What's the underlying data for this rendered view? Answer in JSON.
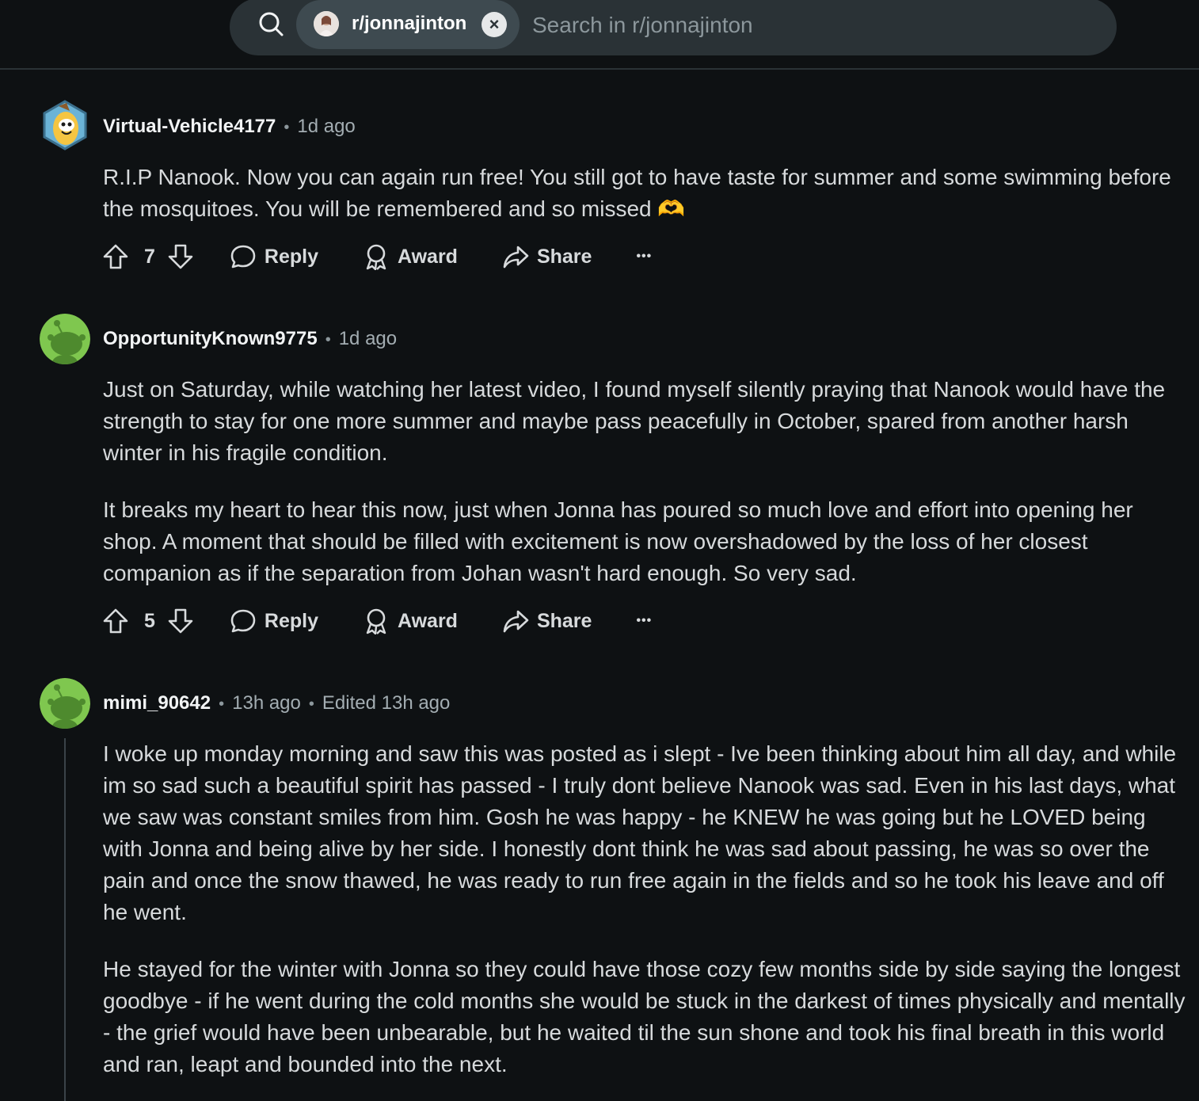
{
  "search": {
    "community_chip": "r/jonnajinton",
    "placeholder": "Search in r/jonnajinton",
    "close_glyph": "×"
  },
  "comments": [
    {
      "author": "Virtual-Vehicle4177",
      "separator": "•",
      "time": "1d ago",
      "paragraphs": [
        "R.I.P Nanook. Now you can again run free! You still got to have taste for summer and some swimming before the mosquitoes. You will be remembered and so missed 🫶"
      ],
      "votes": "7",
      "reply": "Reply",
      "award": "Award",
      "share": "Share",
      "more": "•••"
    },
    {
      "author": "OpportunityKnown9775",
      "separator": "•",
      "time": "1d ago",
      "paragraphs": [
        "Just on Saturday, while watching her latest video, I found myself silently praying that Nanook would have the strength to stay for one more summer and maybe pass peacefully in October, spared from another harsh winter in his fragile condition.",
        "It breaks my heart to hear this now, just when Jonna has poured so much love and effort into opening her shop. A moment that should be filled with excitement is now overshadowed by the loss of her closest companion as if the separation from Johan wasn't hard enough. So very sad."
      ],
      "votes": "5",
      "reply": "Reply",
      "award": "Award",
      "share": "Share",
      "more": "•••"
    },
    {
      "author": "mimi_90642",
      "separator": "•",
      "time": "13h ago",
      "edited": "Edited 13h ago",
      "paragraphs": [
        "I woke up monday morning and saw this was posted as i slept - Ive been thinking about him all day, and while im so sad such a beautiful spirit has passed - I truly dont believe Nanook was sad. Even in his last days, what we saw was constant smiles from him. Gosh he was happy - he KNEW he was going but he LOVED being with Jonna and being alive by her side. I honestly dont think he was sad about passing, he was so over the pain and once the snow thawed, he was ready to run free again in the fields and so he took his leave and off he went.",
        "He stayed for the winter with Jonna so they could have those cozy few months side by side saying the longest goodbye - if he went during the cold months she would be stuck in the darkest of times physically and mentally - the grief would have been unbearable, but he waited til the sun shone and took his final breath in this world and ran, leapt and bounded into the next."
      ]
    }
  ],
  "colors": {
    "background": "#0e1113",
    "search_bg": "#2a3236",
    "snoo_green": "#7fc74f",
    "text": "#d7dadc",
    "muted": "#a3adb2"
  },
  "icons": [
    "search-icon",
    "close-icon",
    "upvote-icon",
    "downvote-icon",
    "reply-icon",
    "award-icon",
    "share-icon",
    "more-icon"
  ]
}
